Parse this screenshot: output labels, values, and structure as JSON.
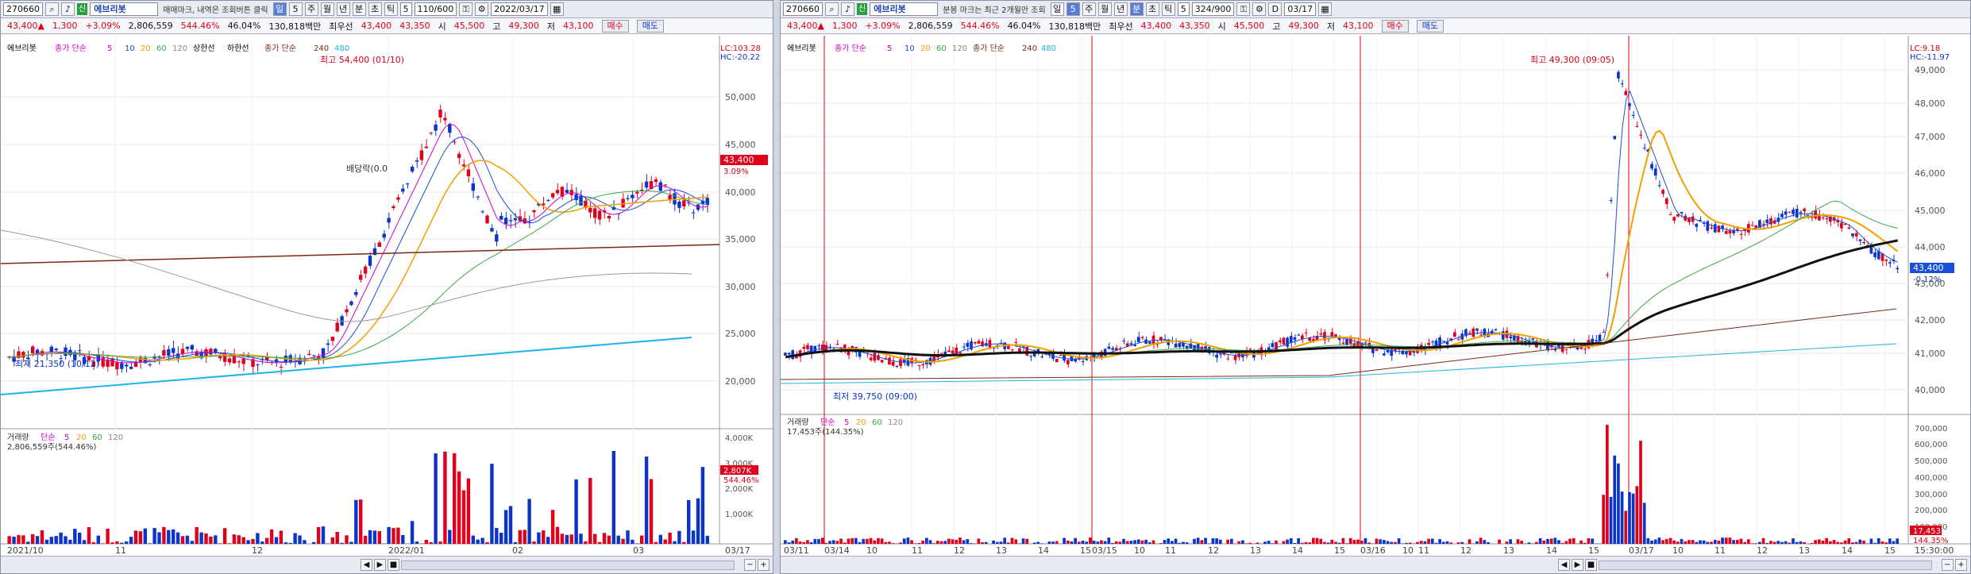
{
  "left": {
    "toolbar": {
      "code": "270660",
      "new_badge": "신",
      "name": "에브리봇",
      "hint": "매매마크, 내역은 조회버튼 클릭",
      "periods": [
        "일",
        "5",
        "주",
        "월",
        "년",
        "분",
        "초",
        "틱"
      ],
      "count": "5",
      "pager": "110/600",
      "date": "2022/03/17"
    },
    "quote": {
      "price": "43,400▲",
      "change": "1,300",
      "rate": "+3.09%",
      "volume": "2,806,559",
      "vol_ratio": "544.46%",
      "turnover": "46.04%",
      "amount": "130,818백만",
      "best": "최우선",
      "ask": "43,400",
      "bid": "43,350",
      "open_l": "시",
      "open": "45,500",
      "high_l": "고",
      "high": "49,300",
      "low_l": "저",
      "low": "43,100",
      "buy": "매수",
      "sell": "매도"
    },
    "legend": {
      "name": "에브리봇",
      "ma_label": "종가 단순",
      "ma": [
        "5",
        "10",
        "20",
        "60",
        "120"
      ],
      "ul": "상한선",
      "ll": "하한선",
      "ma2_label": "종가 단순",
      "ma2": [
        "240",
        "480"
      ],
      "lc": "LC:103.28",
      "hc": "HC:-20.22"
    },
    "annotations": {
      "high": "최고 54,400 (01/10)",
      "low": "최저 21,350 (10/12)",
      "div": "배당락(0.0",
      "cur_price": "43,400",
      "cur_rate": "3.09%"
    },
    "y_labels": [
      "50,000",
      "45,000",
      "40,000",
      "35,000",
      "30,000",
      "25,000",
      "20,000"
    ],
    "vol_legend": {
      "label": "거래량",
      "ma_label": "단순",
      "ma": [
        "5",
        "20",
        "60",
        "120"
      ],
      "value": "2,806,559주(544.46%)"
    },
    "vol_y": [
      "4,000K",
      "3,000K",
      "2,000K",
      "1,000K"
    ],
    "vol_box": "2,807K",
    "vol_rate": "544.46%",
    "x_labels": [
      "2021/10",
      "11",
      "12",
      "2022/01",
      "02",
      "03",
      "03/17"
    ]
  },
  "right": {
    "toolbar": {
      "code": "270660",
      "new_badge": "신",
      "name": "에브리봇",
      "hint": "분봉 마크는 최근 2개월만 조회",
      "periods": [
        "일",
        "5",
        "주",
        "월",
        "년",
        "분",
        "초",
        "틱"
      ],
      "count": "5",
      "pager": "324/900",
      "date": "03/17",
      "d_flag": "D"
    },
    "quote": {
      "price": "43,400▲",
      "change": "1,300",
      "rate": "+3.09%",
      "volume": "2,806,559",
      "vol_ratio": "544.46%",
      "turnover": "46.04%",
      "amount": "130,818백만",
      "best": "최우선",
      "ask": "43,400",
      "bid": "43,350",
      "open_l": "시",
      "open": "45,500",
      "high_l": "고",
      "high": "49,300",
      "low_l": "저",
      "low": "43,100",
      "buy": "매수",
      "sell": "매도"
    },
    "legend": {
      "name": "에브리봇",
      "ma_label": "종가 단순",
      "ma": [
        "5",
        "10",
        "20",
        "60",
        "120"
      ],
      "ma2_label": "종가 단순",
      "ma2": [
        "240",
        "480"
      ],
      "lc": "LC:9.18",
      "hc": "HC:-11.97"
    },
    "annotations": {
      "high": "최고 49,300 (09:05)",
      "low": "최저 39,750 (09:00)",
      "cur_price": "43,400",
      "cur_rate": "-0.12%"
    },
    "y_labels": [
      "49,000",
      "48,000",
      "47,000",
      "46,000",
      "45,000",
      "44,000",
      "43,000",
      "42,000",
      "41,000",
      "40,000"
    ],
    "vol_legend": {
      "label": "거래량",
      "ma_label": "단순",
      "ma": [
        "5",
        "20",
        "60",
        "120"
      ],
      "value": "17,453주(144.35%)"
    },
    "vol_y": [
      "700,000",
      "600,000",
      "500,000",
      "400,000",
      "300,000",
      "200,000",
      "100,000"
    ],
    "vol_box": "17,453",
    "vol_rate": "144.35%",
    "x_labels": [
      "03/11",
      "03/14",
      "10",
      "11",
      "12",
      "13",
      "14",
      "15",
      "03/15",
      "10",
      "11",
      "12",
      "13",
      "14",
      "15",
      "03/16",
      "10",
      "11",
      "12",
      "13",
      "14",
      "15",
      "03/17",
      "10",
      "11",
      "12",
      "13",
      "14",
      "15"
    ],
    "time": "15:30:00"
  },
  "colors": {
    "up": "#e0001b",
    "down": "#0b34c9",
    "ma5": "#d400c8",
    "ma10": "#1a4fd8",
    "ma20": "#f2a000",
    "ma60": "#3aa84a",
    "ma120": "#999999",
    "ma240": "#7a2a12",
    "ma480": "#1fb3e6"
  },
  "icons": [
    "search-icon",
    "speaker-icon",
    "gear-icon",
    "lock-icon",
    "calendar-icon",
    "zoom-in-icon",
    "zoom-out-icon"
  ]
}
